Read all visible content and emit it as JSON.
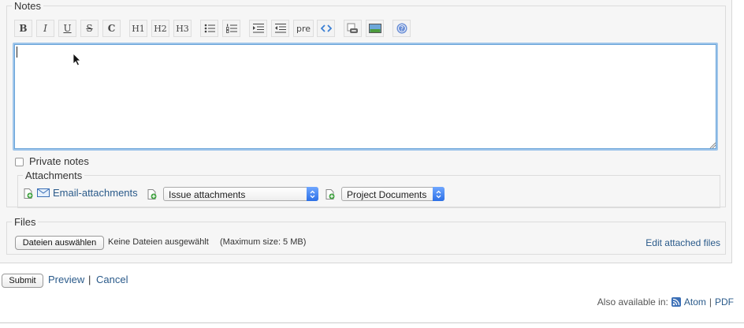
{
  "notes": {
    "legend": "Notes",
    "toolbar": {
      "bold": "B",
      "italic": "I",
      "underline": "U",
      "strike": "S",
      "code": "C",
      "h1": "H1",
      "h2": "H2",
      "h3": "H3",
      "pre": "pre"
    },
    "editor_value": "",
    "private_label": "Private notes",
    "private_checked": false
  },
  "attachments": {
    "legend": "Attachments",
    "email_link": "Email-attachments",
    "issue_select": "Issue attachments",
    "docs_select": "Project Documents"
  },
  "files": {
    "legend": "Files",
    "choose_button": "Dateien auswählen",
    "no_files": "Keine Dateien ausgewählt",
    "max_size": "(Maximum size: 5 MB)",
    "edit_link": "Edit attached files"
  },
  "actions": {
    "submit": "Submit",
    "preview": "Preview",
    "separator": "|",
    "cancel": "Cancel"
  },
  "footer": {
    "also_available": "Also available in:",
    "atom": "Atom",
    "separator": "|",
    "pdf": "PDF"
  },
  "icons": {
    "bullet_list": "bullet-list-icon",
    "numbered_list": "numbered-list-icon",
    "indent": "indent-icon",
    "outdent": "outdent-icon",
    "link": "link-icon",
    "image": "image-icon",
    "help": "help-icon",
    "attach": "add-attachment-icon",
    "email": "email-icon",
    "feed": "feed-icon"
  },
  "colors": {
    "link": "#2a5a8a",
    "editor_border": "#9ec5ea",
    "select_arrow": "#2c6fe6"
  }
}
